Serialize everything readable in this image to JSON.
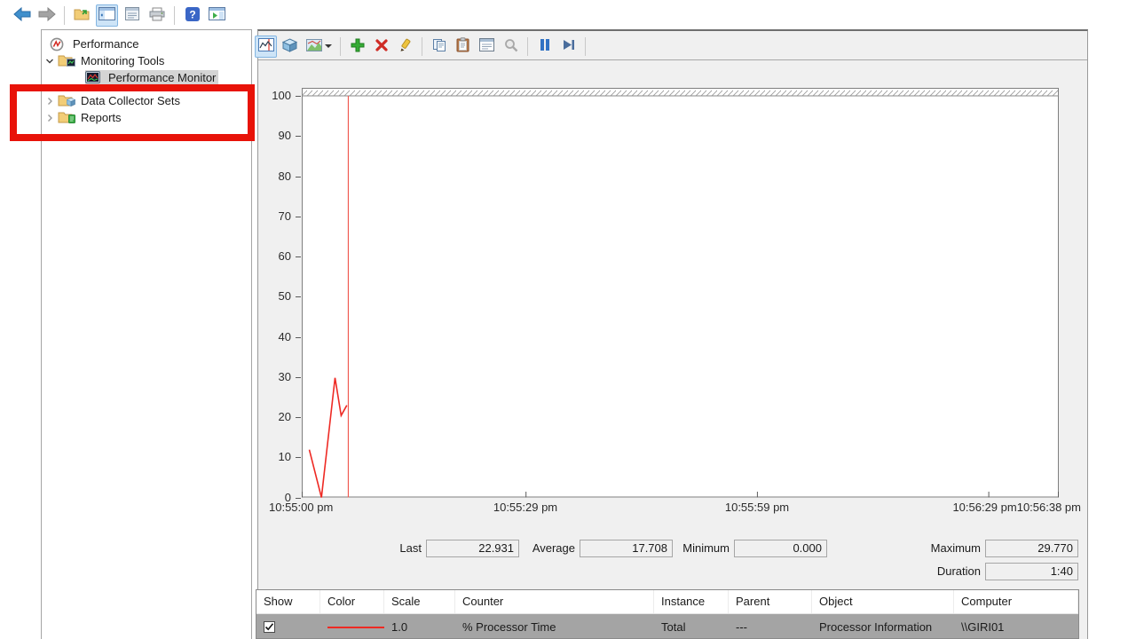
{
  "mmc_toolbar": {
    "icons": [
      "back-arrow",
      "forward-arrow",
      "export-list",
      "show-hide-console-tree",
      "console-properties",
      "print",
      "help",
      "new-window"
    ]
  },
  "sidebar": {
    "items": [
      {
        "label": "Performance",
        "icon": "performance-root-icon",
        "level": 0,
        "expanded": null,
        "selected": false
      },
      {
        "label": "Monitoring Tools",
        "icon": "monitoring-tools-folder-icon",
        "level": 1,
        "expanded": true,
        "selected": false
      },
      {
        "label": "Performance Monitor",
        "icon": "performance-monitor-icon",
        "level": 2,
        "expanded": null,
        "selected": true
      },
      {
        "label": "Data Collector Sets",
        "icon": "data-collector-sets-folder-icon",
        "level": 1,
        "expanded": false,
        "selected": false
      },
      {
        "label": "Reports",
        "icon": "reports-folder-icon",
        "level": 1,
        "expanded": false,
        "selected": false
      }
    ]
  },
  "perfmon_toolbar": {
    "buttons": [
      {
        "name": "view-current-activity",
        "selected": true
      },
      {
        "name": "view-log-data"
      },
      {
        "name": "change-graph-type",
        "has_dropdown": true
      },
      {
        "name": "add-counter"
      },
      {
        "name": "delete-counter"
      },
      {
        "name": "highlight"
      },
      {
        "name": "copy-properties"
      },
      {
        "name": "paste-counter-list"
      },
      {
        "name": "properties"
      },
      {
        "name": "zoom",
        "disabled": true
      },
      {
        "name": "freeze-display"
      },
      {
        "name": "update-data"
      }
    ]
  },
  "chart_data": {
    "type": "line",
    "title": "",
    "xlabel": "",
    "ylabel": "",
    "ylim": [
      0,
      100
    ],
    "grid": false,
    "top_hatch_band": true,
    "y_ticks": [
      100,
      90,
      80,
      70,
      60,
      50,
      40,
      30,
      20,
      10,
      0
    ],
    "x_tick_labels": [
      "10:55:00 pm",
      "10:55:29 pm",
      "10:55:59 pm",
      "10:56:29 pm",
      "10:56:38 pm"
    ],
    "x_tick_fracs": [
      0,
      0.296,
      0.602,
      0.908,
      1.0
    ],
    "cursor_x_frac": 0.0615,
    "series": [
      {
        "name": "% Processor Time",
        "color": "#ee2a24",
        "x_frac": [
          0.01,
          0.026,
          0.044,
          0.052,
          0.0595
        ],
        "values": [
          11.9,
          0.0,
          29.8,
          20.4,
          22.931
        ]
      }
    ]
  },
  "stats": {
    "fields": [
      {
        "label": "Last",
        "value": "22.931"
      },
      {
        "label": "Average",
        "value": "17.708"
      },
      {
        "label": "Minimum",
        "value": "0.000"
      },
      {
        "label": "Maximum",
        "value": "29.770"
      }
    ],
    "duration_label": "Duration",
    "duration_value": "1:40"
  },
  "counter_table": {
    "headers": [
      "Show",
      "Color",
      "Scale",
      "Counter",
      "Instance",
      "Parent",
      "Object",
      "Computer"
    ],
    "rows": [
      {
        "show": true,
        "color": "#ee2a24",
        "scale": "1.0",
        "counter": "% Processor Time",
        "instance": "Total",
        "parent": "---",
        "object": "Processor Information",
        "computer": "\\\\GIRI01",
        "selected": true
      }
    ]
  },
  "annotation": {
    "shape": "rectangle",
    "color": "#e81309"
  }
}
